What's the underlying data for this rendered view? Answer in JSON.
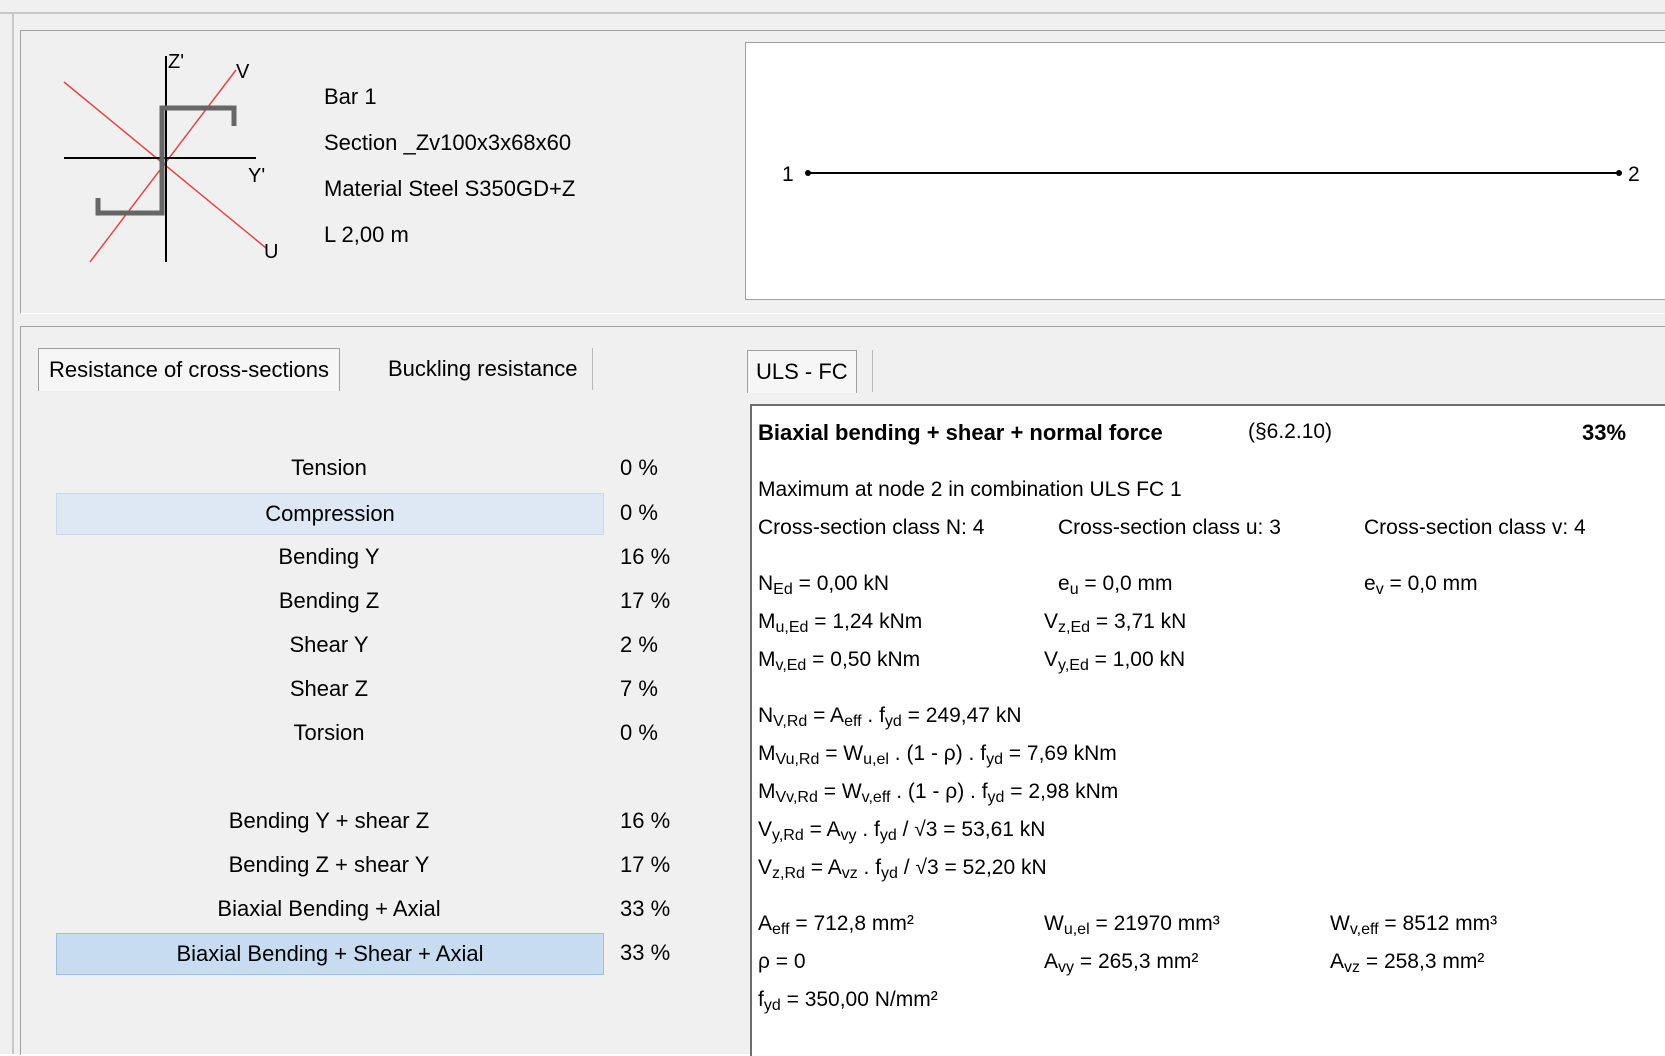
{
  "bar_info": {
    "bar": "Bar 1",
    "section": "Section _Zv100x3x68x60",
    "material": "Material Steel S350GD+Z",
    "length": "L 2,00 m"
  },
  "section_axes": {
    "z_label": "Z'",
    "v_label": "V",
    "y_label": "Y'",
    "u_label": "U"
  },
  "node_view": {
    "node_start": "1",
    "node_end": "2"
  },
  "tabs": {
    "left_active": "Resistance of cross-sections",
    "left_inactive": "Buckling resistance",
    "right_active": "ULS - FC"
  },
  "checks": [
    {
      "label": "Tension",
      "value": "0 %"
    },
    {
      "label": "Compression",
      "value": "0 %"
    },
    {
      "label": "Bending Y",
      "value": "16 %"
    },
    {
      "label": "Bending Z",
      "value": "17 %"
    },
    {
      "label": "Shear Y",
      "value": "2 %"
    },
    {
      "label": "Shear Z",
      "value": "7 %"
    },
    {
      "label": "Torsion",
      "value": "0 %"
    },
    {
      "label": "Bending Y + shear Z",
      "value": "16 %"
    },
    {
      "label": "Bending Z + shear Y",
      "value": "17 %"
    },
    {
      "label": "Biaxial Bending + Axial",
      "value": "33 %"
    },
    {
      "label": "Biaxial Bending + Shear + Axial",
      "value": "33 %"
    }
  ],
  "detail": {
    "title": "Biaxial bending + shear + normal force",
    "ref": "(§6.2.10)",
    "ratio": "33%",
    "max_line": "Maximum at node 2 in combination ULS FC 1",
    "class_n": "Cross-section class N: 4",
    "class_u": "Cross-section class u: 3",
    "class_v": "Cross-section class v: 4",
    "ned": "0,00 kN",
    "eu": "0,0 mm",
    "ev": "0,0 mm",
    "mued": "1,24 kNm",
    "vzed": "3,71 kN",
    "mved": "0,50 kNm",
    "vyed": "1,00 kN",
    "nvrd": "249,47 kN",
    "mvurd": "7,69 kNm",
    "mvvrd": "2,98 kNm",
    "vyrd": "53,61 kN",
    "vzrd": "52,20 kN",
    "aeff": "712,8 mm²",
    "wuel": "21970 mm³",
    "wveff": "8512 mm³",
    "rho": "0",
    "avy": "265,3 mm²",
    "avz": "258,3 mm²",
    "fyd": "350,00 N/mm²"
  }
}
